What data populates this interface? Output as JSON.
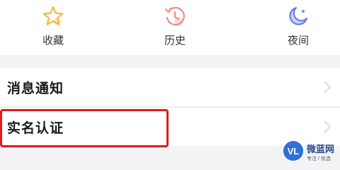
{
  "quick_actions": [
    {
      "label": "收藏",
      "icon": "star-icon",
      "color": "#f4b740"
    },
    {
      "label": "历史",
      "icon": "history-clock-icon",
      "color": "#f08a8a"
    },
    {
      "label": "夜间",
      "icon": "moon-icon",
      "color": "#6a7be8"
    }
  ],
  "settings": {
    "notify_label": "消息通知",
    "realname_label": "实名认证",
    "highlight_color": "#e21b1b"
  },
  "watermark": {
    "title": "微蓝网",
    "subtitle": "专注 / 优选",
    "logo_text": "VL",
    "logo_color": "#2f6fd6"
  }
}
